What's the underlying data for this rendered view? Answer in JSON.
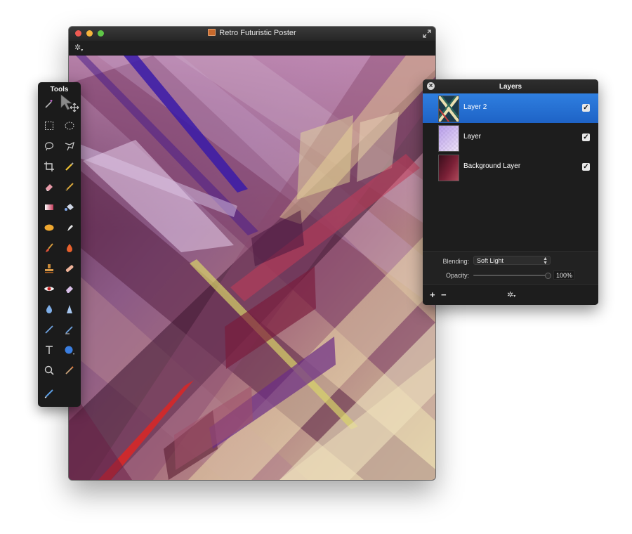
{
  "document": {
    "title": "Retro Futuristic Poster",
    "icons": {
      "title": "document-icon",
      "fullscreen": "fullscreen-icon",
      "settings": "gear-icon"
    }
  },
  "tools": {
    "title": "Tools",
    "items": [
      "magic-wand-icon",
      "move-arrow-icon",
      "rect-select-icon",
      "ellipse-select-icon",
      "lasso-icon",
      "polygon-lasso-icon",
      "crop-icon",
      "eyedropper-icon",
      "eraser-icon",
      "pencil-icon",
      "gradient-icon",
      "paint-bucket-icon",
      "sponge-icon",
      "smudge-icon",
      "brush-icon",
      "burn-icon",
      "stamp-icon",
      "heal-icon",
      "red-eye-icon",
      "eraser-alt-icon",
      "blur-drop-icon",
      "sharpen-icon",
      "pen-icon",
      "freeform-pen-icon",
      "text-icon",
      "shape-icon",
      "zoom-icon",
      "color-picker-icon",
      "color-swatch-icon"
    ]
  },
  "layers": {
    "title": "Layers",
    "items": [
      {
        "name": "Layer 2",
        "visible": true,
        "selected": true
      },
      {
        "name": "Layer",
        "visible": true,
        "selected": false
      },
      {
        "name": "Background Layer",
        "visible": true,
        "selected": false
      }
    ],
    "blending_label": "Blending:",
    "blending_value": "Soft Light",
    "opacity_label": "Opacity:",
    "opacity_value": "100%",
    "opacity_fraction": 1.0,
    "footer": {
      "add": "+",
      "remove": "−"
    }
  },
  "colors": {
    "selection_blue": "#2f7fe0",
    "panel_bg": "#1d1d1d",
    "close": "#ee5a52",
    "minimize": "#f5b43c",
    "zoom": "#5fc647"
  }
}
